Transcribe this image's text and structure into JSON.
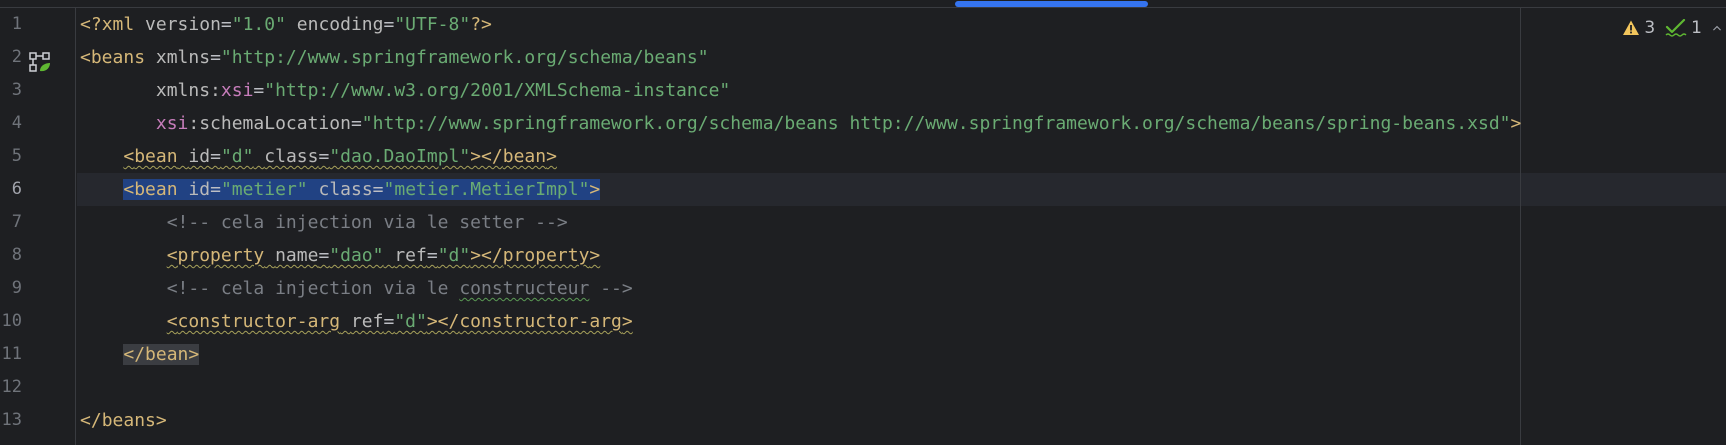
{
  "gutter": {
    "line_numbers": [
      "1",
      "2",
      "3",
      "4",
      "5",
      "6",
      "7",
      "8",
      "9",
      "10",
      "11",
      "12",
      "13"
    ],
    "current_line": "6"
  },
  "status": {
    "warnings_count": "3",
    "typos_count": "1",
    "warning_icon": "warning-triangle-icon",
    "typo_icon": "typo-check-icon",
    "collapse_icon": "chevron-up-icon"
  },
  "code": {
    "l1": {
      "open": "<?",
      "tag": "xml",
      "sp1": " ",
      "a1": "version",
      "eq1": "=",
      "v1": "\"1.0\"",
      "sp2": " ",
      "a2": "encoding",
      "eq2": "=",
      "v2": "\"UTF-8\"",
      "close": "?>"
    },
    "l2": {
      "open": "<",
      "tag": "beans",
      "sp": " ",
      "attr": "xmlns",
      "eq": "=",
      "val": "\"http://www.springframework.org/schema/beans\""
    },
    "l3": {
      "indent": "       ",
      "attr": "xmlns:",
      "ns": "xsi",
      "eq": "=",
      "val": "\"http://www.w3.org/2001/XMLSchema-instance\""
    },
    "l4": {
      "indent": "       ",
      "ns": "xsi",
      "attr": ":schemaLocation",
      "eq": "=",
      "val": "\"http://www.springframework.org/schema/beans http://www.springframework.org/schema/beans/spring-beans.xsd\"",
      "close": ">"
    },
    "l5": {
      "indent": "    ",
      "open": "<",
      "tag": "bean",
      "sp1": " ",
      "a1": "id",
      "eq1": "=",
      "v1": "\"d\"",
      "sp2": " ",
      "a2": "class",
      "eq2": "=",
      "v2": "\"dao.DaoImpl\"",
      "close": "></",
      "ctag": "bean",
      "cend": ">"
    },
    "l6": {
      "indent": "    ",
      "open": "<",
      "tag": "bean",
      "sp1": " ",
      "a1": "id",
      "eq1": "=",
      "v1": "\"metier\"",
      "sp2": " ",
      "a2": "class",
      "eq2": "=",
      "v2": "\"metier.MetierImpl\"",
      "close": ">"
    },
    "l7": {
      "indent": "        ",
      "comment": "<!-- cela injection via le setter -->"
    },
    "l8": {
      "indent": "        ",
      "open": "<",
      "tag": "property",
      "sp1": " ",
      "a1": "name",
      "eq1": "=",
      "v1": "\"dao\"",
      "sp2": " ",
      "a2": "ref",
      "eq2": "=",
      "v2": "\"d\"",
      "close": "></",
      "ctag": "property",
      "cend": ">"
    },
    "l9": {
      "indent": "        ",
      "c1": "<!-- cela injection via le ",
      "typo": "constructeur",
      "c2": " -->"
    },
    "l10": {
      "indent": "        ",
      "open": "<",
      "tag": "constructor-arg",
      "sp1": " ",
      "a1": "ref",
      "eq1": "=",
      "v1": "\"d\"",
      "close": "></",
      "ctag": "constructor-arg",
      "cend": ">"
    },
    "l11": {
      "indent": "    ",
      "text": "</bean>"
    },
    "l13": {
      "open": "</",
      "tag": "beans",
      "close": ">"
    }
  }
}
